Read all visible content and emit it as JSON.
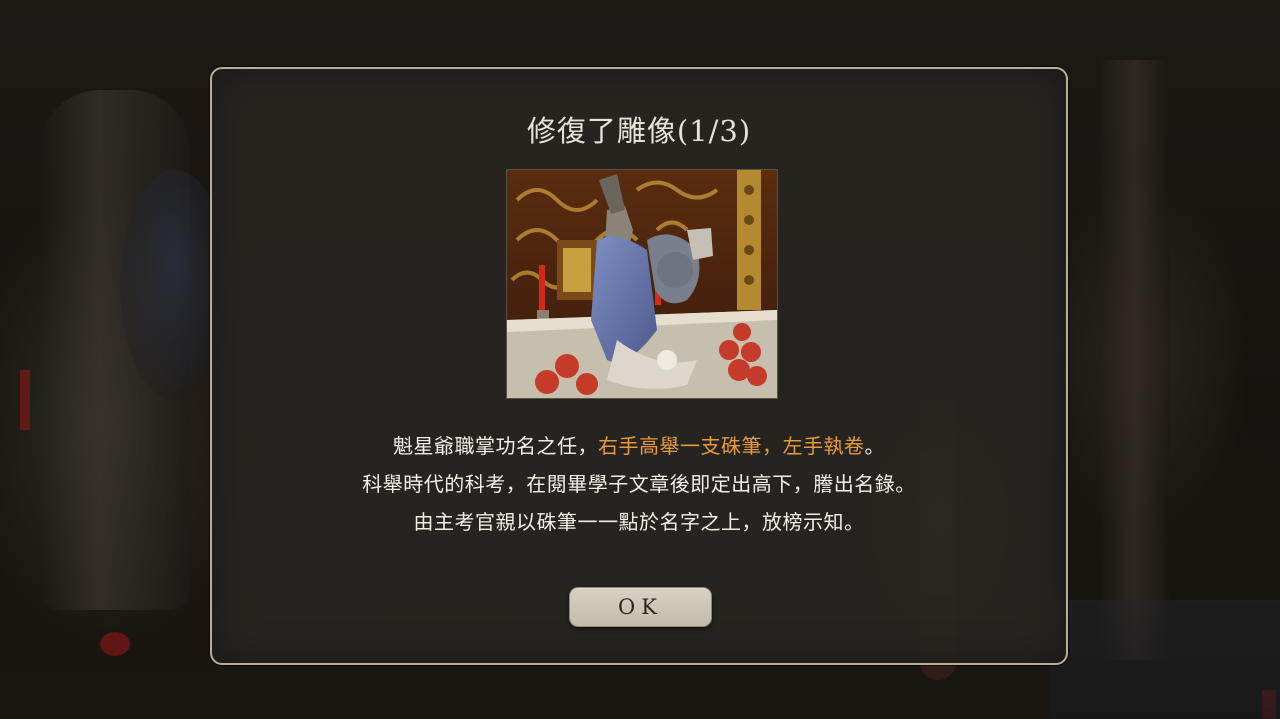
{
  "dialog": {
    "title": "修復了雕像(1/3)",
    "illustration": "statue-image",
    "lines": [
      {
        "prefix": "魁星爺職掌功名之任，",
        "highlight": "右手高舉一支硃筆，左手執卷",
        "suffix": "。"
      },
      {
        "text": "科舉時代的科考，在閱畢學子文章後即定出高下，謄出名錄。"
      },
      {
        "text": "由主考官親以硃筆一一點於名字之上，放榜示知。"
      }
    ],
    "ok_label": "OK"
  },
  "colors": {
    "highlight": "#e79a3e",
    "dialog_border": "#b9ae98",
    "button": "#d2cabb"
  }
}
